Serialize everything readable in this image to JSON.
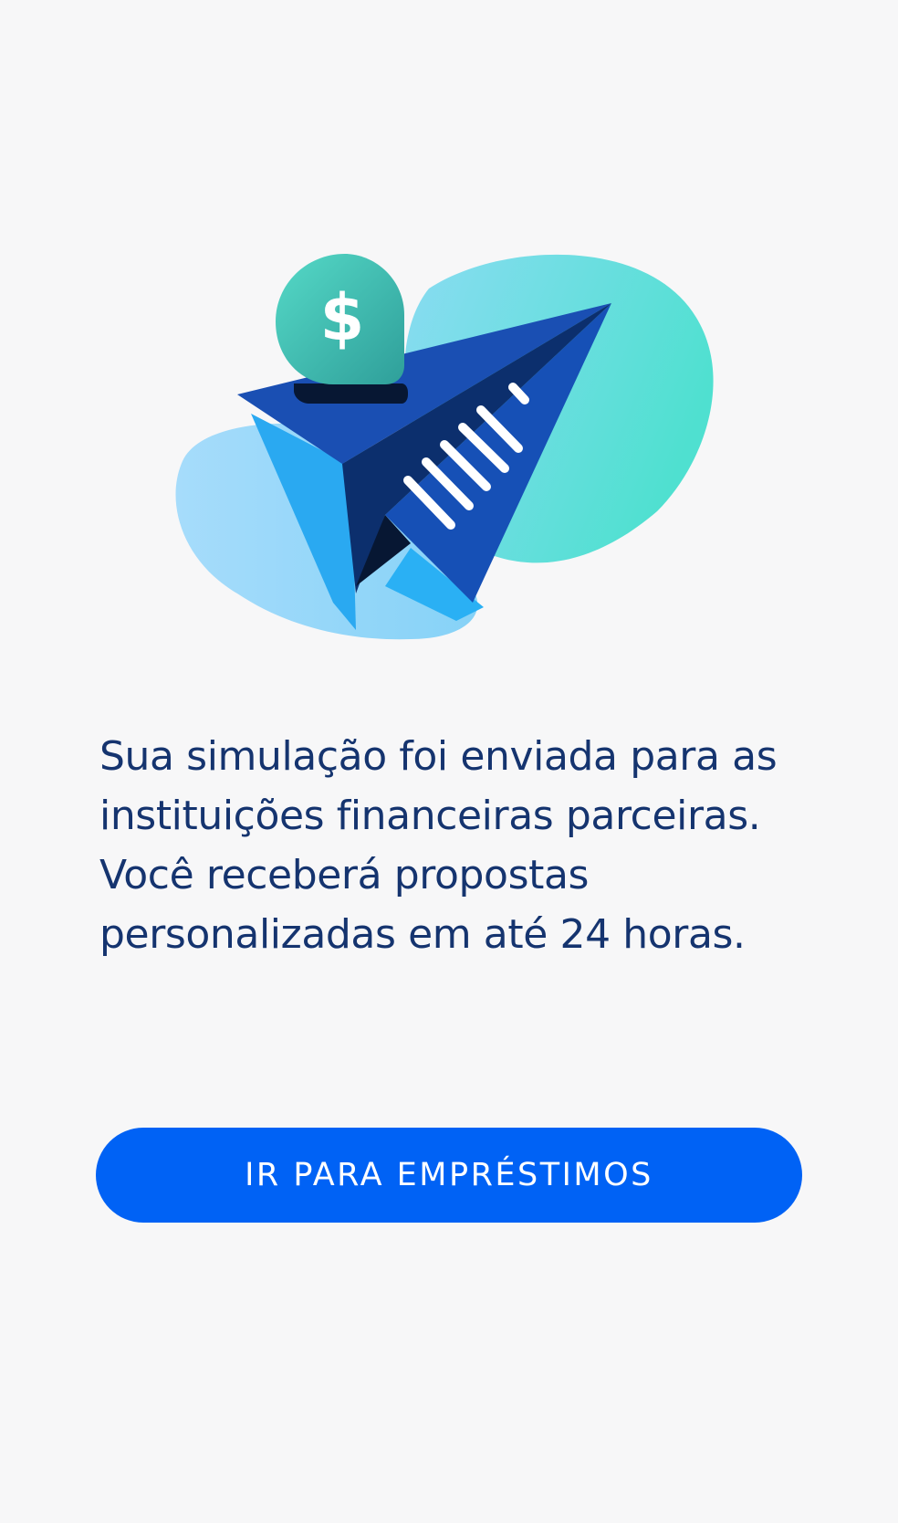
{
  "illustration": {
    "icon": "paper-plane-with-dollar-icon",
    "badge_symbol": "$",
    "colors": {
      "blob_left": "#8ed4fb",
      "blob_right_start": "#7fdbef",
      "blob_right_end": "#4fe0d0",
      "plane_main": "#1650b6",
      "plane_dark": "#0c2f6d",
      "plane_light": "#2aa9f1",
      "badge_start": "#4fd7c6",
      "badge_end": "#2fa89f"
    }
  },
  "main": {
    "message": "Sua simulação foi enviada para as instituições financeiras parceiras. Você receberá propostas personalizadas em até 24 horas."
  },
  "actions": {
    "primary_label": "IR PARA EMPRÉSTIMOS"
  },
  "theme": {
    "background": "#f7f7f8",
    "text": "#15346f",
    "accent": "#0062f5"
  }
}
